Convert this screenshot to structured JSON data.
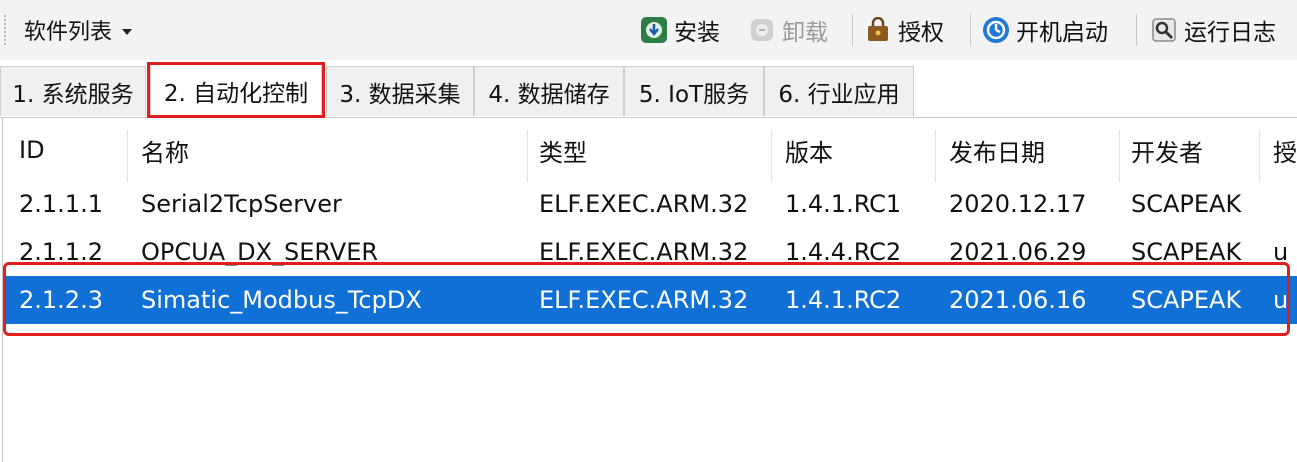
{
  "toolbar": {
    "software_list_label": "软件列表",
    "install_label": "安装",
    "uninstall_label": "卸载",
    "authorize_label": "授权",
    "autostart_label": "开机启动",
    "log_label": "运行日志",
    "icons": [
      "install-icon",
      "uninstall-icon",
      "authorize-icon",
      "autostart-icon",
      "log-icon"
    ]
  },
  "tabs": [
    {
      "label": "1. 系统服务"
    },
    {
      "label": "2. 自动化控制",
      "active": true
    },
    {
      "label": "3. 数据采集"
    },
    {
      "label": "4. 数据储存"
    },
    {
      "label": "5. IoT服务"
    },
    {
      "label": "6. 行业应用"
    }
  ],
  "table": {
    "columns": [
      "ID",
      "名称",
      "类型",
      "版本",
      "发布日期",
      "开发者",
      "授"
    ],
    "rows": [
      {
        "id": "2.1.1.1",
        "name": "Serial2TcpServer",
        "type": "ELF.EXEC.ARM.32",
        "version": "1.4.1.RC1",
        "date": "2020.12.17",
        "developer": "SCAPEAK",
        "auth": ""
      },
      {
        "id": "2.1.1.2",
        "name": "OPCUA_DX_SERVER",
        "type": "ELF.EXEC.ARM.32",
        "version": "1.4.4.RC2",
        "date": "2021.06.29",
        "developer": "SCAPEAK",
        "auth": "u"
      },
      {
        "id": "2.1.2.3",
        "name": "Simatic_Modbus_TcpDX",
        "type": "ELF.EXEC.ARM.32",
        "version": "1.4.1.RC2",
        "date": "2021.06.16",
        "developer": "SCAPEAK",
        "auth": "u",
        "selected": true
      }
    ]
  },
  "colors": {
    "selection": "#1170d6",
    "highlight_box": "#e21d1d",
    "toolbar_bg": "#f3f3f3"
  }
}
